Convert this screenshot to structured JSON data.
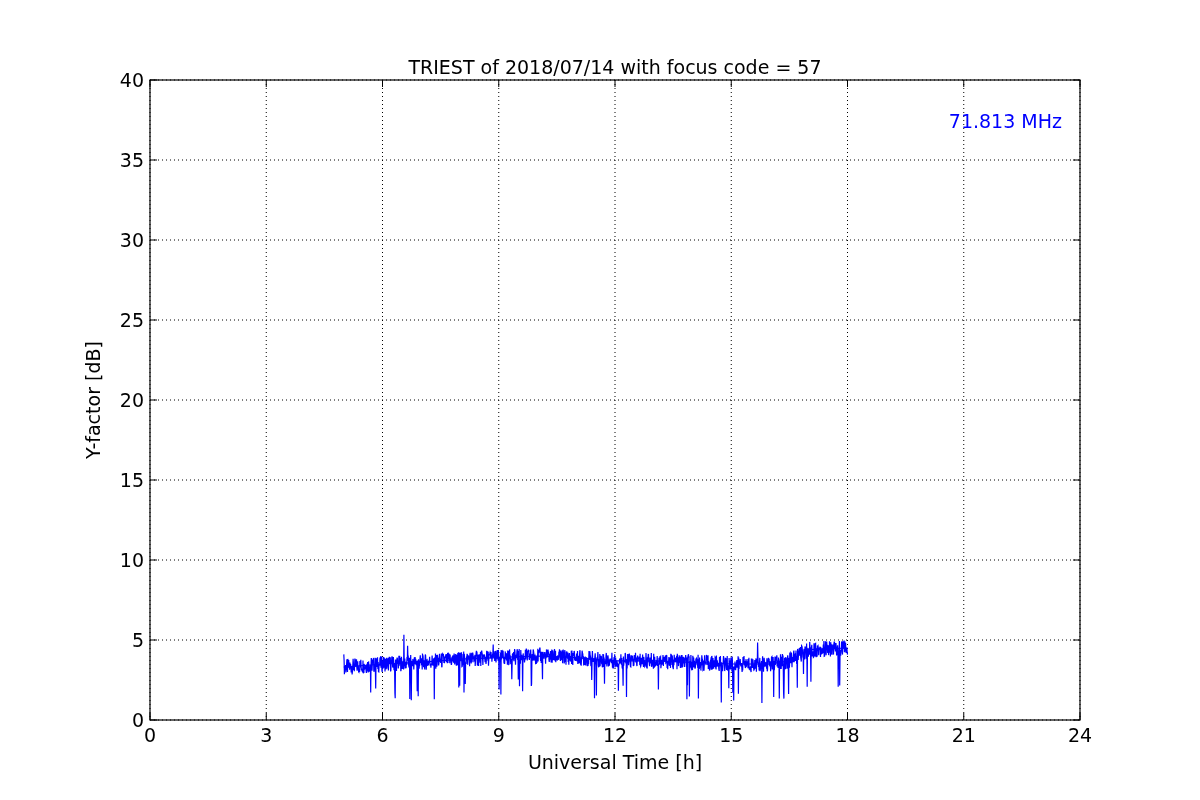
{
  "chart_data": {
    "type": "line",
    "title": "TRIEST of 2018/07/14 with focus code = 57",
    "xlabel": "Universal Time [h]",
    "ylabel": "Y-factor [dB]",
    "xlim": [
      0,
      24
    ],
    "ylim": [
      0,
      40
    ],
    "xticks": [
      0,
      3,
      6,
      9,
      12,
      15,
      18,
      21,
      24
    ],
    "yticks": [
      0,
      5,
      10,
      15,
      20,
      25,
      30,
      35,
      40
    ],
    "grid": true,
    "series": [
      {
        "name": "71.813 MHz",
        "color": "#0000ff",
        "x": [
          5,
          6,
          7,
          8,
          9,
          10,
          11,
          12,
          13,
          14,
          15,
          16,
          16.5,
          17,
          18
        ],
        "values": [
          3.3,
          3.5,
          3.6,
          3.8,
          3.9,
          4.0,
          3.9,
          3.7,
          3.7,
          3.6,
          3.5,
          3.5,
          3.7,
          4.4,
          4.5
        ]
      }
    ]
  }
}
